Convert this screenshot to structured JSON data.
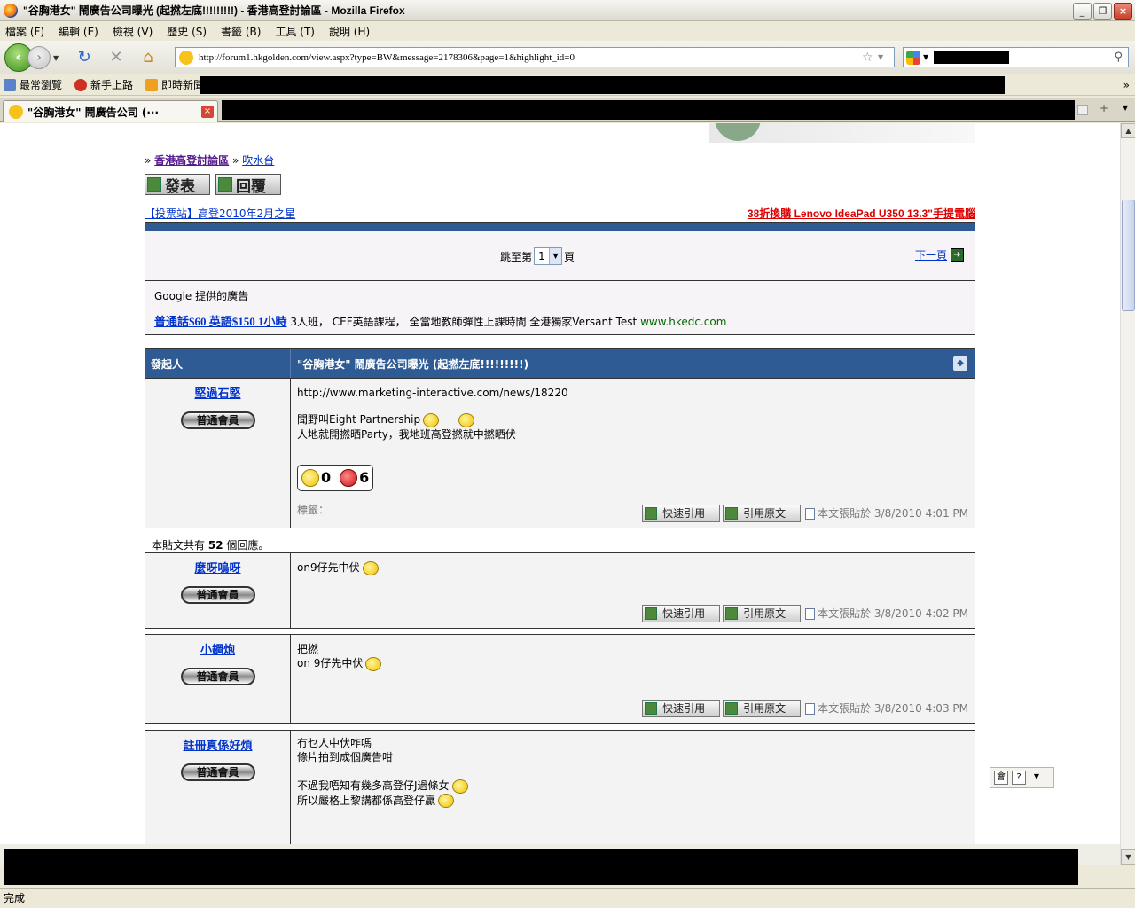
{
  "window": {
    "title": "\"谷胸港女\" 鬧廣告公司曝光 (起撚左底!!!!!!!!!) - 香港高登討論區 - Mozilla Firefox"
  },
  "menu": [
    "檔案 (F)",
    "編輯 (E)",
    "檢視 (V)",
    "歷史 (S)",
    "書籤 (B)",
    "工具 (T)",
    "說明 (H)"
  ],
  "nav": {
    "url": "http://forum1.hkgolden.com/view.aspx?type=BW&message=2178306&page=1&highlight_id=0"
  },
  "bookmarks": [
    "最常瀏覽",
    "新手上路",
    "即時新聞"
  ],
  "tab": {
    "label": "\"谷胸港女\" 鬧廣告公司 (···",
    "close": "×"
  },
  "breadcrumb": {
    "sep": "»",
    "forum": "香港高登討論區",
    "board": "吹水台"
  },
  "actions": {
    "post": "發表",
    "reply": "回覆"
  },
  "promo": {
    "vote": "【投票站】高登2010年2月之星",
    "ad": "38折換購 Lenovo IdeaPad U350 13.3\"手提電腦"
  },
  "pager": {
    "jump_prefix": "跳至第",
    "jump_suffix": "頁",
    "page": "1",
    "next": "下一頁"
  },
  "ads": {
    "label": "Google 提供的廣告",
    "link": "普通話$60 英語$150 1小時",
    "text": "3人班， CEF英語課程， 全當地教師彈性上課時間 全港獨家Versant Test",
    "url": "www.hkedc.com"
  },
  "thread": {
    "author_header": "發起人",
    "title": "\"谷胸港女\" 鬧廣告公司曝光 (起撚左底!!!!!!!!!)"
  },
  "opening_post": {
    "author": "堅過石堅",
    "rank": "普通會員",
    "line1": "http://www.marketing-interactive.com/news/18220",
    "line2": "聞野叫Eight Partnership",
    "line3": "人地就開撚晒Party，我地班高登撚就中撚晒伏",
    "good": "0",
    "bad": "6",
    "tags_label": "標籤：",
    "quick_quote": "快速引用",
    "quote": "引用原文",
    "posted": "本文張貼於 3/8/2010 4:01 PM"
  },
  "reply_count": {
    "prefix": "本貼文共有",
    "count": "52",
    "suffix": "個回應。"
  },
  "replies": [
    {
      "author": "麼呀嗚呀",
      "rank": "普通會員",
      "lines": [
        "on9仔先中伏"
      ],
      "posted": "本文張貼於 3/8/2010 4:02 PM"
    },
    {
      "author": "小鋼炮",
      "rank": "普通會員",
      "lines": [
        "把撚",
        "on 9仔先中伏"
      ],
      "posted": "本文張貼於 3/8/2010 4:03 PM"
    },
    {
      "author": "註冊真係好煩",
      "rank": "普通會員",
      "lines": [
        "冇乜人中伏咋嗎",
        "條片拍到成個廣告咁",
        "",
        "不過我唔知有幾多高登仔J過條女",
        "所以嚴格上黎講都係高登仔贏"
      ],
      "posted": ""
    }
  ],
  "status": {
    "text": "完成"
  }
}
